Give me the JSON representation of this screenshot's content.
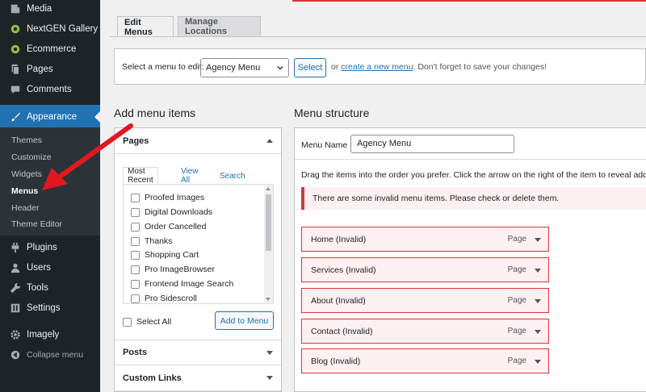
{
  "sidebar": {
    "items": [
      {
        "label": "Media",
        "icon": "media-icon"
      },
      {
        "label": "NextGEN Gallery",
        "icon": "nextgen-gallery-icon"
      },
      {
        "label": "Ecommerce",
        "icon": "ecommerce-icon"
      },
      {
        "label": "Pages",
        "icon": "pages-icon"
      },
      {
        "label": "Comments",
        "icon": "comments-icon"
      },
      {
        "label": "Appearance",
        "icon": "paintbrush-icon"
      },
      {
        "label": "Plugins",
        "icon": "plugins-icon"
      },
      {
        "label": "Users",
        "icon": "users-icon"
      },
      {
        "label": "Tools",
        "icon": "wrench-icon"
      },
      {
        "label": "Settings",
        "icon": "settings-icon"
      },
      {
        "label": "Imagely",
        "icon": "gear-icon"
      },
      {
        "label": "Collapse menu",
        "icon": "collapse-icon"
      }
    ],
    "submenu": [
      "Themes",
      "Customize",
      "Widgets",
      "Menus",
      "Header",
      "Theme Editor"
    ],
    "current_submenu": "Menus",
    "accent": "#2271b1"
  },
  "tabs": {
    "edit_menus": "Edit Menus",
    "manage_locations": "Manage Locations"
  },
  "select_menu": {
    "label": "Select a menu to edit:",
    "selected": "Agency Menu",
    "button": "Select",
    "or_text": "or",
    "create_link": "create a new menu",
    "reminder": ". Don't forget to save your changes!"
  },
  "add_items": {
    "heading": "Add menu items",
    "pages_section": "Pages",
    "inner_tabs": [
      "Most Recent",
      "View All",
      "Search"
    ],
    "pages": [
      "Proofed Images",
      "Digital Downloads",
      "Order Cancelled",
      "Thanks",
      "Shopping Cart",
      "Pro ImageBrowser",
      "Frontend Image Search",
      "Pro Sidescroll"
    ],
    "select_all": "Select All",
    "add_button": "Add to Menu",
    "posts_section": "Posts",
    "custom_links_section": "Custom Links"
  },
  "structure": {
    "heading": "Menu structure",
    "menu_name_label": "Menu Name",
    "menu_name_value": "Agency Menu",
    "drag_text": "Drag the items into the order you prefer. Click the arrow on the right of the item to reveal additional",
    "notice": "There are some invalid menu items. Please check or delete them.",
    "items": [
      {
        "title": "Home (Invalid)",
        "type": "Page"
      },
      {
        "title": "Services (Invalid)",
        "type": "Page"
      },
      {
        "title": "About (Invalid)",
        "type": "Page"
      },
      {
        "title": "Contact (Invalid)",
        "type": "Page"
      },
      {
        "title": "Blog (Invalid)",
        "type": "Page"
      }
    ],
    "invalid_color": "#d63638"
  }
}
